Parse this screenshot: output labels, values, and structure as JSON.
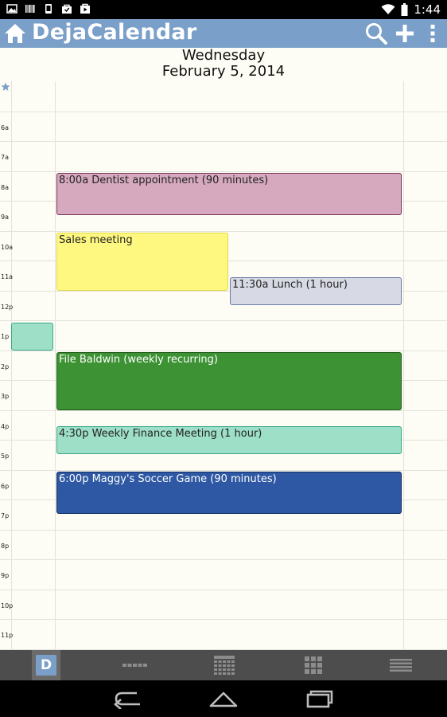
{
  "status_bar": {
    "time": "1:44",
    "left_icons": [
      "image-icon",
      "barcode-icon",
      "phone-icon",
      "shopping-bag-icon",
      "play-store-icon"
    ],
    "right_icons": [
      "wifi-icon",
      "battery-icon"
    ]
  },
  "action_bar": {
    "title": "DejaCalendar",
    "actions": [
      "search-icon",
      "add-icon",
      "overflow-menu-icon"
    ]
  },
  "date_header": {
    "weekday": "Wednesday",
    "date": "February 5, 2014"
  },
  "hour_labels": [
    "6a",
    "7a",
    "8a",
    "9a",
    "10a",
    "11a",
    "12p",
    "1p",
    "2p",
    "3p",
    "4p",
    "5p",
    "6p",
    "7p",
    "8p",
    "9p",
    "10p",
    "11p"
  ],
  "events": [
    {
      "title": "8:00a Dentist appointment (90 minutes)",
      "start": "8:00a",
      "duration_minutes": 90,
      "color": "#d6a9bf",
      "border": "#7a3056",
      "text_color": "#222222"
    },
    {
      "title": "Sales meeting",
      "start": "10:00a",
      "color": "#fff880",
      "border": "#e0d84a",
      "text_color": "#222222"
    },
    {
      "title": "11:30a Lunch (1 hour)",
      "start": "11:30a",
      "duration_minutes": 60,
      "color": "#d7d9e4",
      "border": "#6a7aa8",
      "text_color": "#222222"
    },
    {
      "title": "",
      "start": "1:00p",
      "color": "#9ddfc7",
      "border": "#3aa789",
      "text_color": "#222222"
    },
    {
      "title": "File Baldwin (weekly recurring)",
      "start": "2:00p",
      "color": "#3d9234",
      "border": "#1f5a19",
      "text_color": "#ffffff"
    },
    {
      "title": "4:30p Weekly Finance Meeting (1 hour)",
      "start": "4:30p",
      "duration_minutes": 60,
      "color": "#9ddfc7",
      "border": "#3aa789",
      "text_color": "#222222"
    },
    {
      "title": "6:00p Maggy's Soccer Game (90 minutes)",
      "start": "6:00p",
      "duration_minutes": 90,
      "color": "#2e58a3",
      "border": "#0e2a60",
      "text_color": "#ffffff"
    }
  ],
  "bottom_nav": {
    "selected": "day",
    "day_badge": "D",
    "items": [
      "day-view-icon",
      "agenda-view-icon",
      "week-view-icon",
      "month-view-icon",
      "list-view-icon"
    ]
  },
  "colors": {
    "action_bar": "#7a9fc8",
    "background": "#fdfdf5",
    "grid_line": "#e3e3dc",
    "bottom_nav": "#4d4d4d"
  }
}
